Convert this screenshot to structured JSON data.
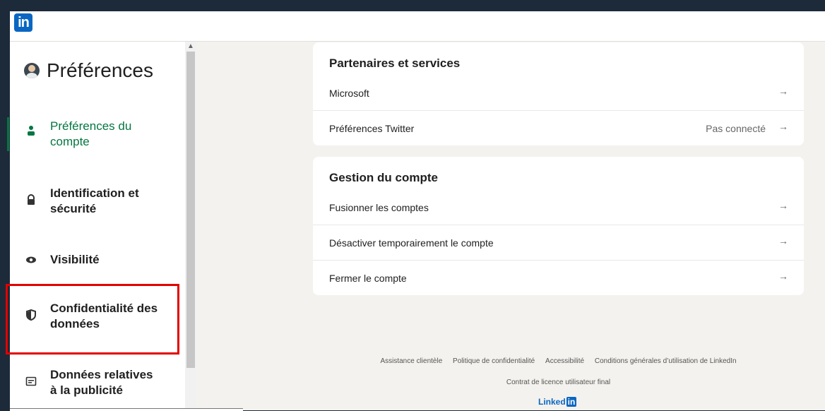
{
  "brand": {
    "logo": "in"
  },
  "sidebar": {
    "title": "Préférences",
    "items": [
      {
        "label_line1": "Préférences du",
        "label_line2": "compte",
        "icon": "person-icon",
        "active": true
      },
      {
        "label_line1": "Identification et",
        "label_line2": "sécurité",
        "icon": "lock-icon"
      },
      {
        "label_line1": "Visibilité",
        "label_line2": "",
        "icon": "eye-icon"
      },
      {
        "label_line1": "Confidentialité des",
        "label_line2": "données",
        "icon": "shield-icon"
      },
      {
        "label_line1": "Données relatives",
        "label_line2": "à la publicité",
        "icon": "ad-icon"
      }
    ]
  },
  "sections": [
    {
      "title": "Partenaires et services",
      "rows": [
        {
          "label": "Microsoft",
          "status": ""
        },
        {
          "label": "Préférences Twitter",
          "status": "Pas connecté"
        }
      ]
    },
    {
      "title": "Gestion du compte",
      "rows": [
        {
          "label": "Fusionner les comptes",
          "status": ""
        },
        {
          "label": "Désactiver temporairement le compte",
          "status": ""
        },
        {
          "label": "Fermer le compte",
          "status": ""
        }
      ]
    }
  ],
  "footer": {
    "links": [
      "Assistance clientèle",
      "Politique de confidentialité",
      "Accessibilité",
      "Conditions générales d’utilisation de LinkedIn"
    ],
    "second": "Contrat de licence utilisateur final",
    "brand_text": "Linked",
    "brand_in": "in"
  },
  "colors": {
    "accent": "#057642",
    "brand": "#0a66c2",
    "highlight": "#e30000"
  }
}
